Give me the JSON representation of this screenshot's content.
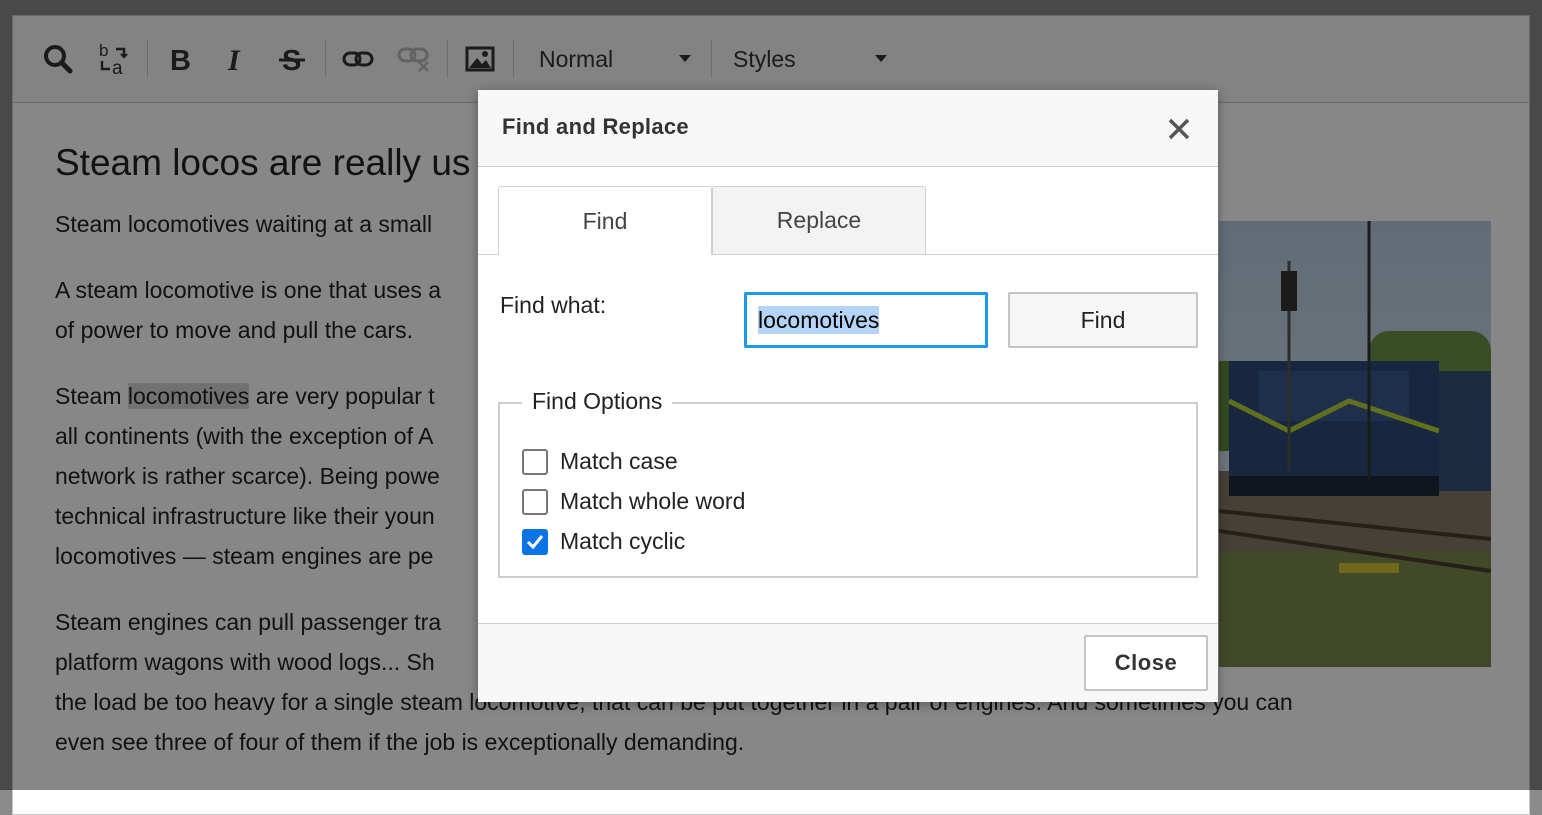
{
  "toolbar": {
    "icons": [
      "search-icon",
      "replace-icon",
      "bold-icon",
      "italic-icon",
      "strikethrough-icon",
      "link-icon",
      "unlink-icon",
      "image-icon"
    ],
    "format_value": "Normal",
    "styles_value": "Styles"
  },
  "content": {
    "heading": "Steam locos are really us",
    "p1": "Steam locomotives waiting at a small",
    "p2_l1": "A steam locomotive is one that uses a",
    "p2_l2": "of power to move and pull the cars.",
    "p3_pre": "Steam ",
    "p3_hl": "locomotives",
    "p3_post": " are very popular t",
    "p3_l2": "all continents (with the exception of A",
    "p3_l3": "network is rather scarce). Being powe",
    "p3_l4": "technical infrastructure like their youn",
    "p3_l5": "locomotives — steam engines are pe",
    "p4_l1": "Steam engines can pull passenger tra",
    "p4_l2": "platform wagons with wood logs... Sh",
    "p4_l3": "the load be too heavy for a single steam locomotive, that can be put together in a pair of engines. And sometimes you can",
    "p4_l4": "even see three of four of them if the job is exceptionally demanding."
  },
  "dialog": {
    "title": "Find and Replace",
    "tabs": [
      {
        "label": "Find",
        "active": true
      },
      {
        "label": "Replace",
        "active": false
      }
    ],
    "find_what_label": "Find what:",
    "find_value": "locomotives",
    "find_button": "Find",
    "options_legend": "Find Options",
    "options": [
      {
        "label": "Match case",
        "checked": false
      },
      {
        "label": "Match whole word",
        "checked": false
      },
      {
        "label": "Match cyclic",
        "checked": true
      }
    ],
    "close_button": "Close"
  },
  "colors": {
    "accent": "#0a74e6",
    "focus_border": "#1a9be8",
    "selection": "#b3d4f7"
  }
}
